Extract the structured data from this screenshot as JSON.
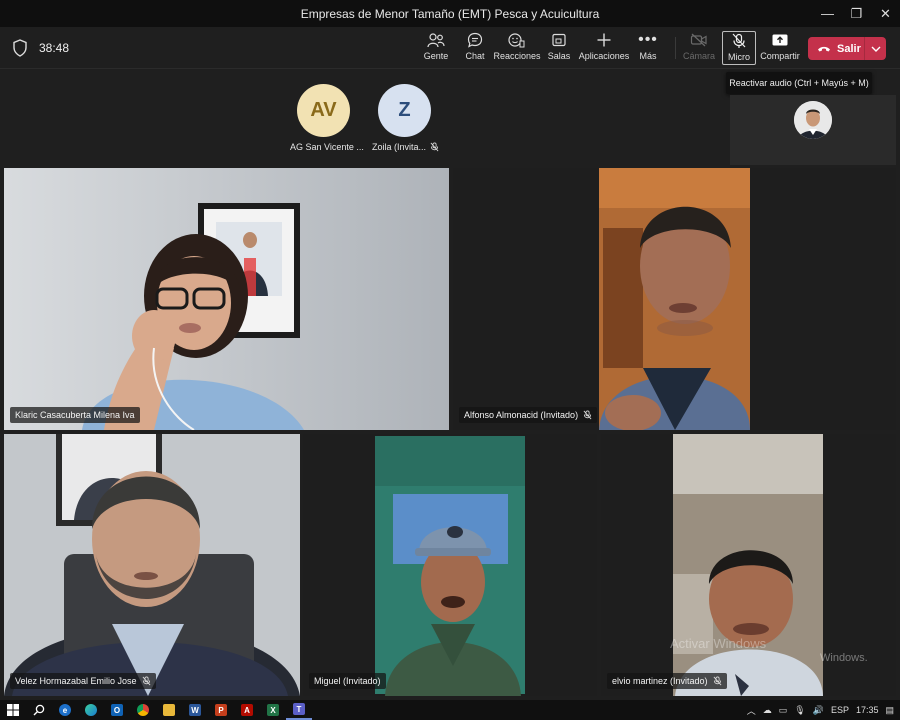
{
  "window": {
    "title": "Empresas de Menor Tamaño (EMT) Pesca y Acuicultura",
    "controls": [
      "minimize",
      "maximize",
      "close"
    ]
  },
  "meeting": {
    "timer": "38:48",
    "toolbar": {
      "people": "Gente",
      "chat": "Chat",
      "reactions": "Reacciones",
      "rooms": "Salas",
      "apps": "Aplicaciones",
      "more": "Más",
      "camera": "Cámara",
      "mic": "Micro",
      "share": "Compartir",
      "leave": "Salir"
    },
    "tooltip": "Reactivar audio (Ctrl + Mayús + M)"
  },
  "participants_top": [
    {
      "initials": "AV",
      "name": "AG San Vicente ...",
      "muted": false
    },
    {
      "initials": "Z",
      "name": "Zoila (Invita...",
      "muted": true
    }
  ],
  "tiles": [
    {
      "name": "Klaric Casacuberta Milena Iva",
      "muted": false
    },
    {
      "name": "Alfonso Almonacid (Invitado)",
      "muted": true
    },
    {
      "name": "Velez Hormazabal Emilio Jose",
      "muted": true
    },
    {
      "name": "Miguel (Invitado)",
      "muted": false
    },
    {
      "name": "elvio martinez (Invitado)",
      "muted": true
    }
  ],
  "watermark": {
    "line1": "Activar Windows",
    "line2": "Windows."
  },
  "taskbar": {
    "apps": [
      {
        "icon": "windows-start-icon",
        "letter": ""
      },
      {
        "icon": "search-icon",
        "letter": ""
      },
      {
        "icon": "edge-icon",
        "letter": "e"
      },
      {
        "icon": "edge-new-icon",
        "letter": ""
      },
      {
        "icon": "outlook-icon",
        "letter": "O"
      },
      {
        "icon": "chrome-icon",
        "letter": ""
      },
      {
        "icon": "folder-icon",
        "letter": ""
      },
      {
        "icon": "word-icon",
        "letter": "W"
      },
      {
        "icon": "powerpoint-icon",
        "letter": "P"
      },
      {
        "icon": "acrobat-icon",
        "letter": "A"
      },
      {
        "icon": "excel-icon",
        "letter": "X"
      },
      {
        "icon": "teams-icon",
        "letter": "T"
      }
    ],
    "language": "ESP",
    "time": "17:35"
  },
  "colors": {
    "leave": "#c4314b",
    "active_speaker": "#8b8cc7",
    "avatar_av": "#f2e2b3",
    "avatar_z": "#d7e1f0"
  }
}
